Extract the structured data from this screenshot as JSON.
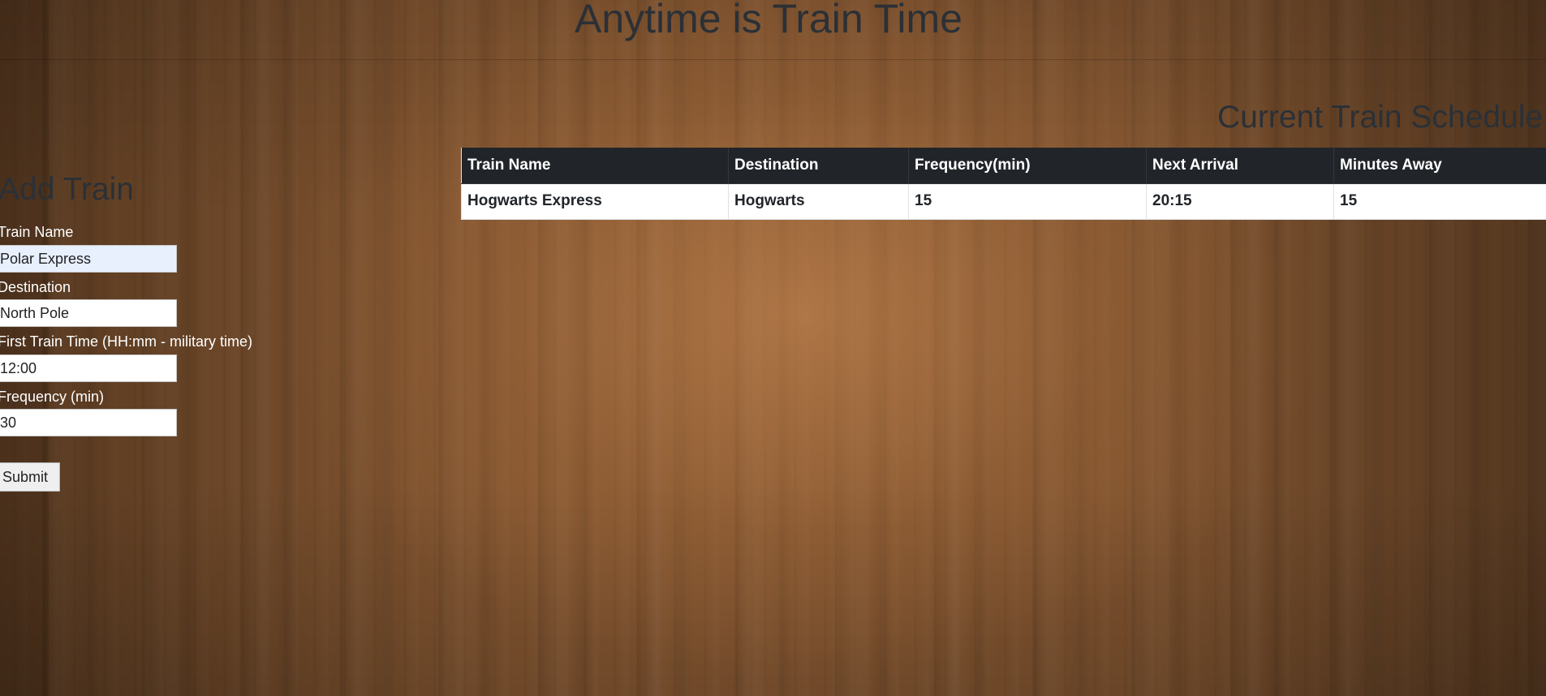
{
  "header": {
    "title": "Anytime is Train Time"
  },
  "schedule": {
    "title": "Current Train Schedule",
    "columns": [
      "Train Name",
      "Destination",
      "Frequency(min)",
      "Next Arrival",
      "Minutes Away"
    ],
    "rows": [
      [
        "Hogwarts Express",
        "Hogwarts",
        "15",
        "20:15",
        "15"
      ]
    ]
  },
  "form": {
    "title": "Add Train",
    "train_name": {
      "label": "Train Name",
      "value": "Polar Express"
    },
    "destination": {
      "label": "Destination",
      "value": "North Pole"
    },
    "first_time": {
      "label": "First Train Time (HH:mm - military time)",
      "value": "12:00"
    },
    "frequency": {
      "label": "Frequency (min)",
      "value": "30"
    },
    "submit_label": "Submit"
  }
}
